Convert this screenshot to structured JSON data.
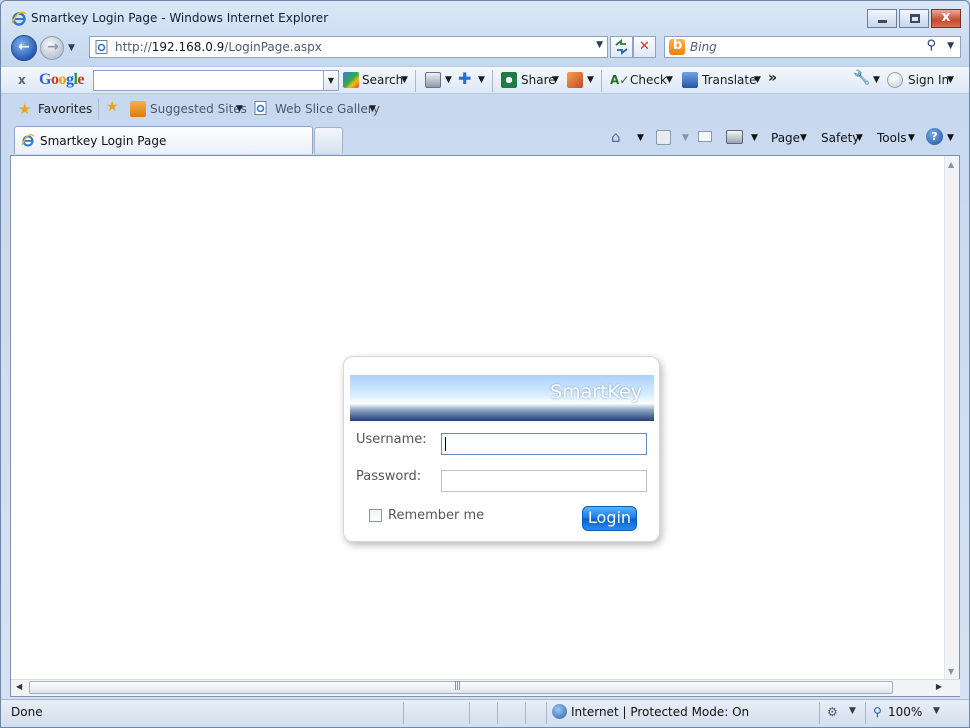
{
  "window": {
    "title": "Smartkey Login Page - Windows Internet Explorer",
    "min_icon": "minimize-icon",
    "max_icon": "maximize-icon",
    "close_label": "x"
  },
  "address_bar": {
    "url_prefix": "http://",
    "url_host": "192.168.0.9",
    "url_path": "/LoginPage.aspx",
    "search_placeholder": "Bing",
    "refresh_icon": "refresh-icon",
    "stop_label": "✕"
  },
  "google_toolbar": {
    "close_label": "x",
    "logo": "Google",
    "search_value": "",
    "items": [
      "Search",
      "Share",
      "Check",
      "Translate",
      "Sign In"
    ],
    "more_label": "»"
  },
  "favorites_bar": {
    "favorites_label": "Favorites",
    "suggested_label": "Suggested Sites",
    "webslice_label": "Web Slice Gallery"
  },
  "tabs": {
    "active_tab": "Smartkey Login Page"
  },
  "command_bar": {
    "page_label": "Page",
    "safety_label": "Safety",
    "tools_label": "Tools",
    "help_label": "?"
  },
  "login": {
    "brand": "SmartKey",
    "username_label": "Username:",
    "username_value": "",
    "password_label": "Password:",
    "password_value": "",
    "remember_label": "Remember me",
    "remember_checked": false,
    "login_button": "Login"
  },
  "scrollbar": {
    "grip": "|||"
  },
  "status_bar": {
    "status": "Done",
    "zone": "Internet | Protected Mode: On",
    "zoom": "100%"
  },
  "colors": {
    "accent_blue": "#1677e6",
    "banner_dark": "#243f72",
    "window_frame": "#c9d9ee"
  }
}
